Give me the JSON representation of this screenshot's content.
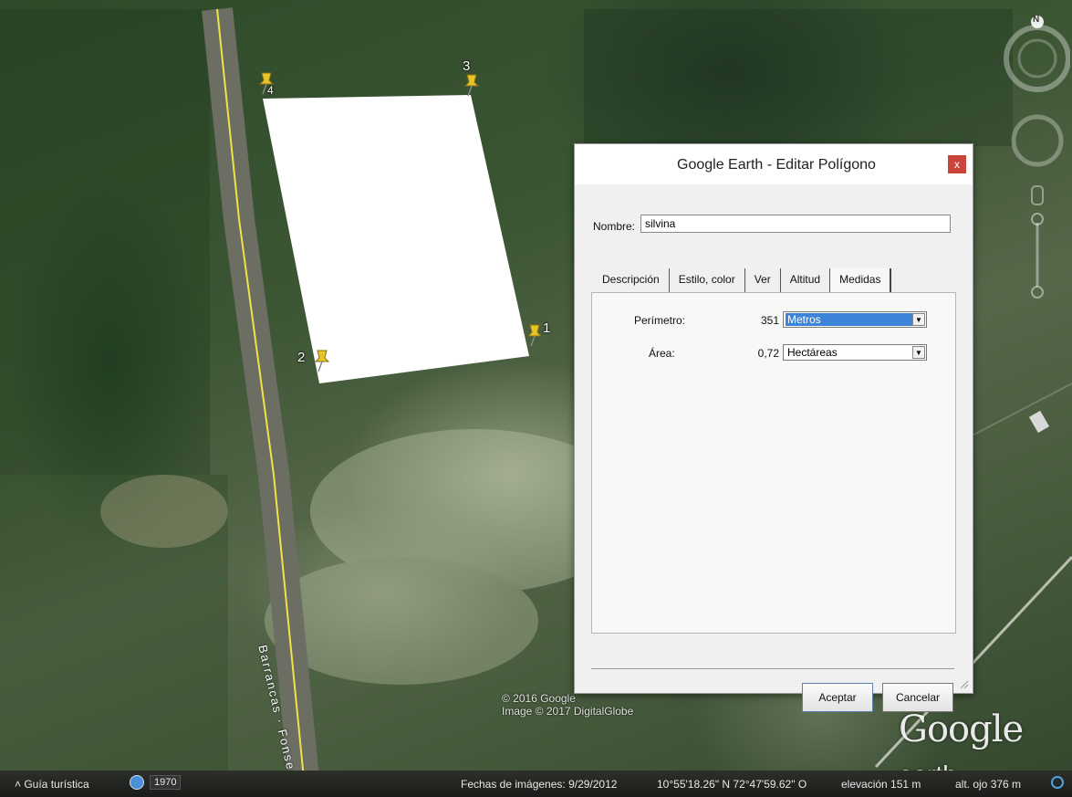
{
  "map": {
    "pins": [
      {
        "num": "1"
      },
      {
        "num": "2"
      },
      {
        "num": "3"
      },
      {
        "num": "4"
      }
    ],
    "road_label": "Barrancas · Fonseca",
    "watermark": {
      "line1": "© 2016 Google",
      "line2": "Image © 2017 DigitalGlobe"
    },
    "logo": {
      "word": "Google",
      "suffix": "earth"
    },
    "compass_label": "N",
    "colors": {
      "polygon_fill": "#ffffff",
      "road": "#f2e24a",
      "pin": "#e6c42a"
    }
  },
  "statusbar": {
    "tour_label": "Guía turística",
    "history_year": "1970",
    "imagery_dates": "Fechas de imágenes: 9/29/2012",
    "coordinates": "10°55'18.26\" N   72°47'59.62\" O",
    "elevation": "elevación   151 m",
    "eye_alt": "alt. ojo   376 m"
  },
  "dialog": {
    "title": "Google Earth - Editar Polígono",
    "close": "x",
    "name_label": "Nombre:",
    "name_value": "silvina",
    "tabs": [
      {
        "label": "Descripción"
      },
      {
        "label": "Estilo, color"
      },
      {
        "label": "Ver"
      },
      {
        "label": "Altitud"
      },
      {
        "label": "Medidas"
      }
    ],
    "active_tab": "Medidas",
    "perimeter": {
      "label": "Perímetro:",
      "value": "351",
      "unit": "Metros"
    },
    "area": {
      "label": "Área:",
      "value": "0,72",
      "unit": "Hectáreas"
    },
    "ok_label": "Aceptar",
    "cancel_label": "Cancelar"
  }
}
